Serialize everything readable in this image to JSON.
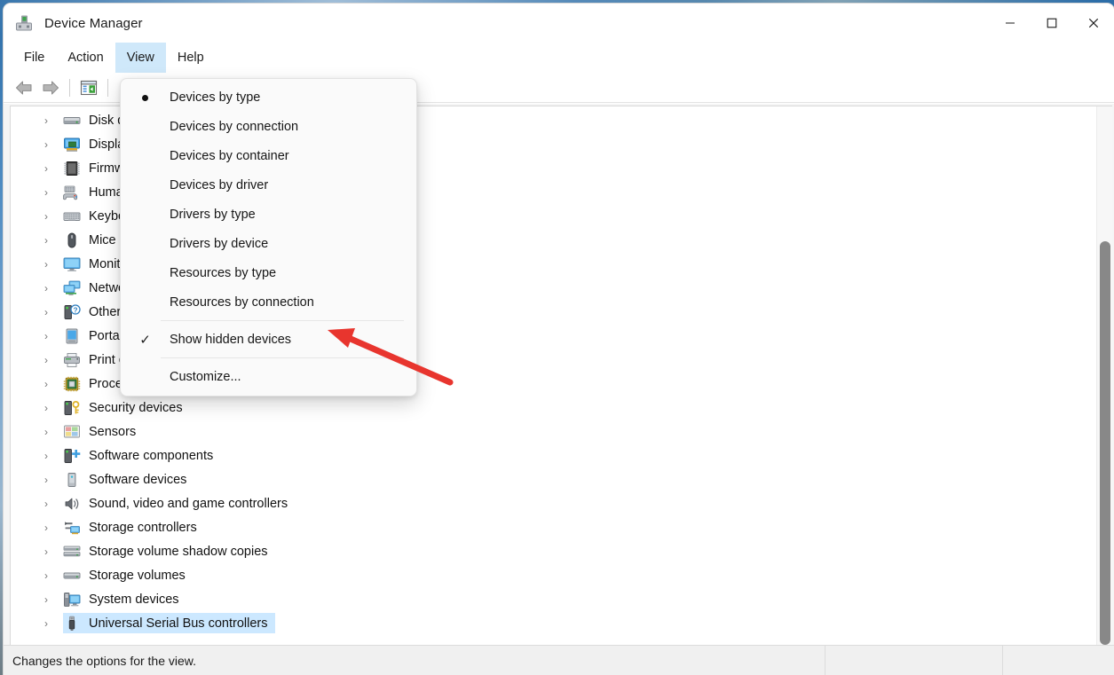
{
  "window": {
    "title": "Device Manager",
    "icon": "device-manager-icon",
    "controls": {
      "minimize": "—",
      "maximize": "□",
      "close": "✕"
    }
  },
  "menubar": {
    "items": [
      {
        "label": "File",
        "active": false
      },
      {
        "label": "Action",
        "active": false
      },
      {
        "label": "View",
        "active": true
      },
      {
        "label": "Help",
        "active": false
      }
    ]
  },
  "toolbar": {
    "buttons": [
      {
        "name": "back-button",
        "icon": "back-arrow-icon"
      },
      {
        "name": "forward-button",
        "icon": "forward-arrow-icon"
      },
      {
        "name": "properties-button",
        "icon": "properties-window-icon"
      }
    ]
  },
  "view_menu": {
    "open": true,
    "items": [
      {
        "label": "Devices by type",
        "mark": "bullet",
        "separator_after": false
      },
      {
        "label": "Devices by connection",
        "mark": "none",
        "separator_after": false
      },
      {
        "label": "Devices by container",
        "mark": "none",
        "separator_after": false
      },
      {
        "label": "Devices by driver",
        "mark": "none",
        "separator_after": false
      },
      {
        "label": "Drivers by type",
        "mark": "none",
        "separator_after": false
      },
      {
        "label": "Drivers by device",
        "mark": "none",
        "separator_after": false
      },
      {
        "label": "Resources by type",
        "mark": "none",
        "separator_after": false
      },
      {
        "label": "Resources by connection",
        "mark": "none",
        "separator_after": true
      },
      {
        "label": "Show hidden devices",
        "mark": "check",
        "separator_after": true
      },
      {
        "label": "Customize...",
        "mark": "none",
        "separator_after": false
      }
    ]
  },
  "tree": {
    "rows": [
      {
        "label": "Disk drives",
        "icon": "disk-drive-icon",
        "selected": false
      },
      {
        "label": "Display adapters",
        "icon": "display-adapter-icon",
        "selected": false
      },
      {
        "label": "Firmware",
        "icon": "firmware-chip-icon",
        "selected": false
      },
      {
        "label": "Human Interface Devices",
        "icon": "hid-icon",
        "selected": false
      },
      {
        "label": "Keyboards",
        "icon": "keyboard-icon",
        "selected": false
      },
      {
        "label": "Mice and other pointing devices",
        "icon": "mouse-icon",
        "selected": false
      },
      {
        "label": "Monitors",
        "icon": "monitor-icon",
        "selected": false
      },
      {
        "label": "Network adapters",
        "icon": "network-adapter-icon",
        "selected": false
      },
      {
        "label": "Other devices",
        "icon": "unknown-device-icon",
        "selected": false
      },
      {
        "label": "Portable Devices",
        "icon": "portable-device-icon",
        "selected": false
      },
      {
        "label": "Print queues",
        "icon": "printer-icon",
        "selected": false
      },
      {
        "label": "Processors",
        "icon": "processor-icon",
        "selected": false
      },
      {
        "label": "Security devices",
        "icon": "security-device-icon",
        "selected": false
      },
      {
        "label": "Sensors",
        "icon": "sensor-icon",
        "selected": false
      },
      {
        "label": "Software components",
        "icon": "software-component-icon",
        "selected": false
      },
      {
        "label": "Software devices",
        "icon": "software-device-icon",
        "selected": false
      },
      {
        "label": "Sound, video and game controllers",
        "icon": "sound-icon",
        "selected": false
      },
      {
        "label": "Storage controllers",
        "icon": "storage-controller-icon",
        "selected": false
      },
      {
        "label": "Storage volume shadow copies",
        "icon": "shadow-copy-icon",
        "selected": false
      },
      {
        "label": "Storage volumes",
        "icon": "storage-volume-icon",
        "selected": false
      },
      {
        "label": "System devices",
        "icon": "system-device-icon",
        "selected": false
      },
      {
        "label": "Universal Serial Bus controllers",
        "icon": "usb-icon",
        "selected": true
      }
    ],
    "expander_glyph": "›",
    "selection_color": "#cce8ff"
  },
  "statusbar": {
    "message": "Changes the options for the view.",
    "pane2": "",
    "pane3": ""
  },
  "annotation": {
    "type": "arrow",
    "color": "#e8352e",
    "points_to": "Show hidden devices"
  }
}
